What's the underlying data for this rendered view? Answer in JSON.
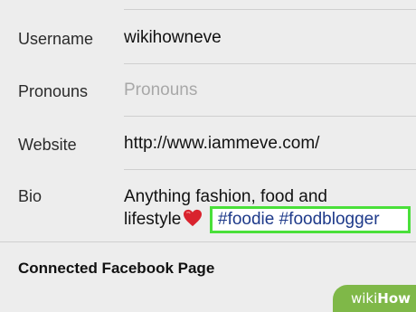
{
  "profile_form": {
    "rows": [
      {
        "label": "Username",
        "value": "wikihowneve",
        "is_placeholder": false
      },
      {
        "label": "Pronouns",
        "value": "Pronouns",
        "is_placeholder": true
      },
      {
        "label": "Website",
        "value": "http://www.iammeve.com/",
        "is_placeholder": false
      }
    ],
    "bio": {
      "label": "Bio",
      "text_line1": "Anything fashion, food and",
      "text_line2": "lifestyle",
      "hashtags": "#foodie #foodblogger"
    }
  },
  "section": {
    "connected_facebook_page": "Connected Facebook Page"
  },
  "watermark": {
    "wiki": "wiki",
    "how": "How"
  },
  "colors": {
    "background": "#ededed",
    "highlight_border": "#4ae03a",
    "hashtag_text": "#1e3a8a",
    "watermark_bg": "#7fb848",
    "heart": "#d9232e"
  },
  "icons": [
    "heart-emoji-icon"
  ]
}
